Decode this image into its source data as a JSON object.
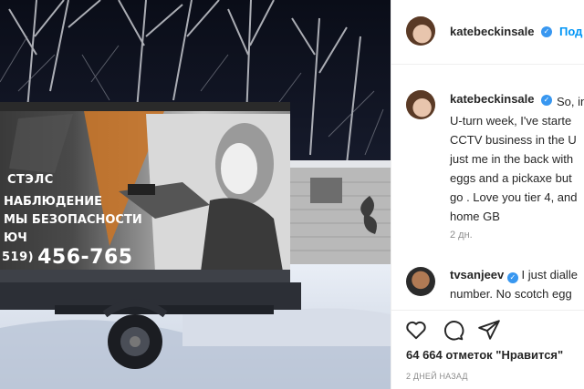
{
  "photo": {
    "ad_brand": "СТЭЛС",
    "ad_line1": "НАБЛЮДЕНИЕ",
    "ad_line2": "МЫ БЕЗОПАСНОСТИ",
    "ad_line3": "ЮЧ",
    "ad_phone_code": "519)",
    "ad_phone_number": "456-765"
  },
  "header": {
    "username": "katebeckinsale",
    "follow_label": "Под"
  },
  "caption": {
    "username": "katebeckinsale",
    "text": "So, in\nU-turn week, I've starte\nCCTV business in the U\njust me in the back with\neggs and a pickaxe but\ngo . Love you tier 4, and\nhome GB",
    "time_ago": "2 дн."
  },
  "comment": {
    "username": "tvsanjeev",
    "text": "I just dialle\nnumber. No scotch egg"
  },
  "actions": {
    "like_icon": "heart-icon",
    "comment_icon": "comment-bubble-icon",
    "share_icon": "paper-plane-icon"
  },
  "likes_text": "64 664 отметок \"Нравится\"",
  "post_date": "2 ДНЕЙ НАЗАД",
  "colors": {
    "link_blue": "#0095f6",
    "verified_blue": "#3897f0",
    "muted": "#8e8e8e"
  }
}
